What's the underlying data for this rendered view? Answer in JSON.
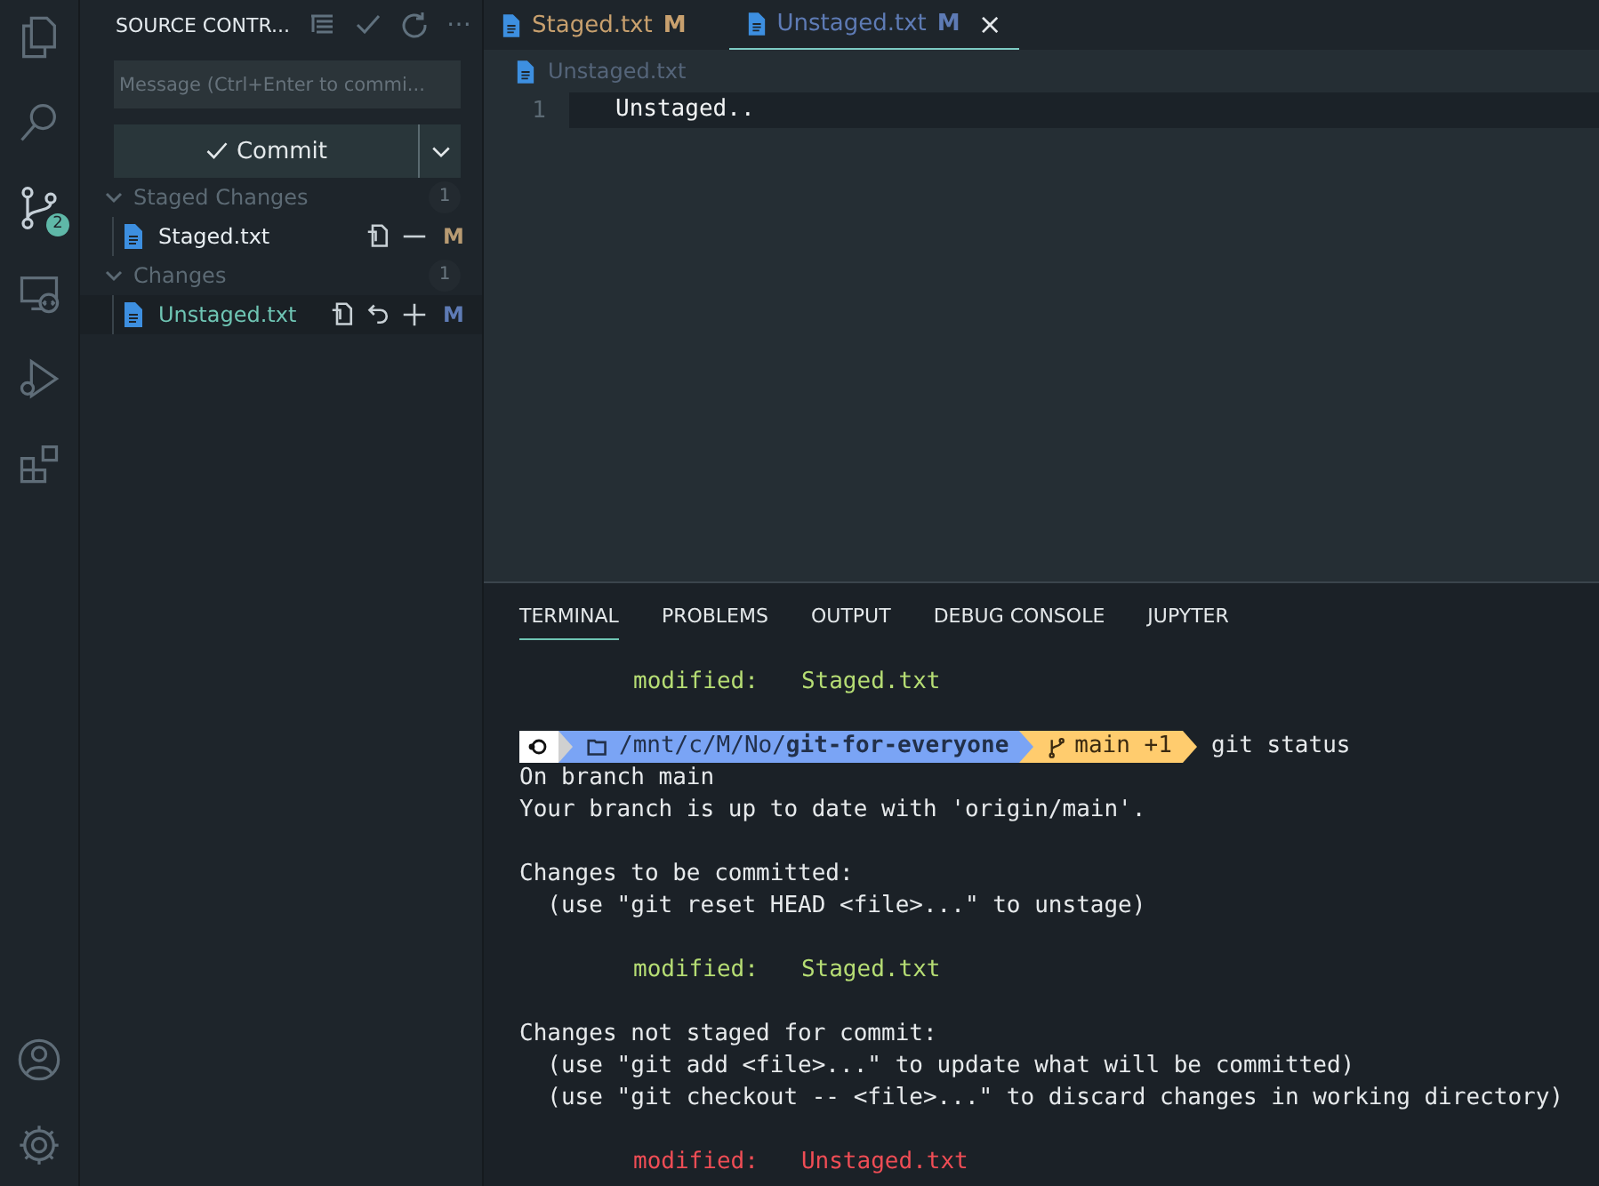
{
  "activity_bar": {
    "items": [
      {
        "kind": "files",
        "selected": false
      },
      {
        "kind": "search",
        "selected": false
      },
      {
        "kind": "source-control",
        "selected": true,
        "badge": "2"
      },
      {
        "kind": "remote",
        "selected": false
      },
      {
        "kind": "debug",
        "selected": false
      },
      {
        "kind": "extensions",
        "selected": false
      }
    ],
    "bottom": [
      {
        "kind": "account"
      },
      {
        "kind": "settings"
      }
    ]
  },
  "sidebar": {
    "title": "SOURCE CONTR...",
    "actions": [
      {
        "kind": "tree"
      },
      {
        "kind": "check"
      },
      {
        "kind": "refresh"
      },
      {
        "kind": "more",
        "text": "⋯"
      }
    ],
    "message": {
      "placeholder": "Message (Ctrl+Enter to commi..."
    },
    "commit_button": {
      "label": "Commit"
    },
    "groups": [
      {
        "title": "Staged Changes",
        "count": "1",
        "expanded": true,
        "files": [
          {
            "name": "Staged.txt",
            "status": "M",
            "color": "#b89b72",
            "selected": false,
            "actions": [
              {
                "kind": "open"
              },
              {
                "kind": "unstage"
              }
            ]
          }
        ]
      },
      {
        "title": "Changes",
        "count": "1",
        "expanded": true,
        "files": [
          {
            "name": "Unstaged.txt",
            "status": "M",
            "color": "#5e7bb5",
            "selected": true,
            "actions": [
              {
                "kind": "open"
              },
              {
                "kind": "discard"
              },
              {
                "kind": "stage"
              }
            ]
          }
        ]
      }
    ]
  },
  "editor": {
    "tabs": [
      {
        "name": "Staged.txt",
        "status": "M",
        "color": "#c8a06e",
        "selected": false
      },
      {
        "name": "Unstaged.txt",
        "status": "M",
        "color": "#5e7bb5",
        "selected": true,
        "close": "×"
      }
    ],
    "breadcrumb": "Unstaged.txt",
    "lines": [
      {
        "number": "1",
        "text": "Unstaged.."
      }
    ]
  },
  "panel": {
    "tabs": [
      {
        "label": "TERMINAL",
        "selected": true
      },
      {
        "label": "PROBLEMS",
        "selected": false
      },
      {
        "label": "OUTPUT",
        "selected": false
      },
      {
        "label": "DEBUG CONSOLE",
        "selected": false
      },
      {
        "label": "JUPYTER",
        "selected": false
      }
    ],
    "terminal": [
      {
        "kind": "modified",
        "color": "#b6dd74",
        "label": "modified:",
        "file": "Staged.txt"
      },
      {
        "kind": "blank"
      },
      {
        "kind": "prompt",
        "path": "/mnt/c/M/No/**git-for-everyone**",
        "branch": "main +1",
        "command": "git status"
      },
      {
        "kind": "text",
        "text": "On branch main"
      },
      {
        "kind": "text",
        "text": "Your branch is up to date with 'origin/main'."
      },
      {
        "kind": "blank"
      },
      {
        "kind": "text",
        "text": "Changes to be committed:"
      },
      {
        "kind": "text",
        "text": "  (use \"git reset HEAD <file>...\" to unstage)"
      },
      {
        "kind": "blank"
      },
      {
        "kind": "modified",
        "color": "#b6dd74",
        "label": "modified:",
        "file": "Staged.txt"
      },
      {
        "kind": "blank"
      },
      {
        "kind": "text",
        "text": "Changes not staged for commit:"
      },
      {
        "kind": "text",
        "text": "  (use \"git add <file>...\" to update what will be committed)"
      },
      {
        "kind": "text",
        "text": "  (use \"git checkout -- <file>...\" to discard changes in working directory)"
      },
      {
        "kind": "blank"
      },
      {
        "kind": "modified",
        "color": "#ef4d55",
        "label": "modified:",
        "file": "Unstaged.txt"
      }
    ]
  }
}
